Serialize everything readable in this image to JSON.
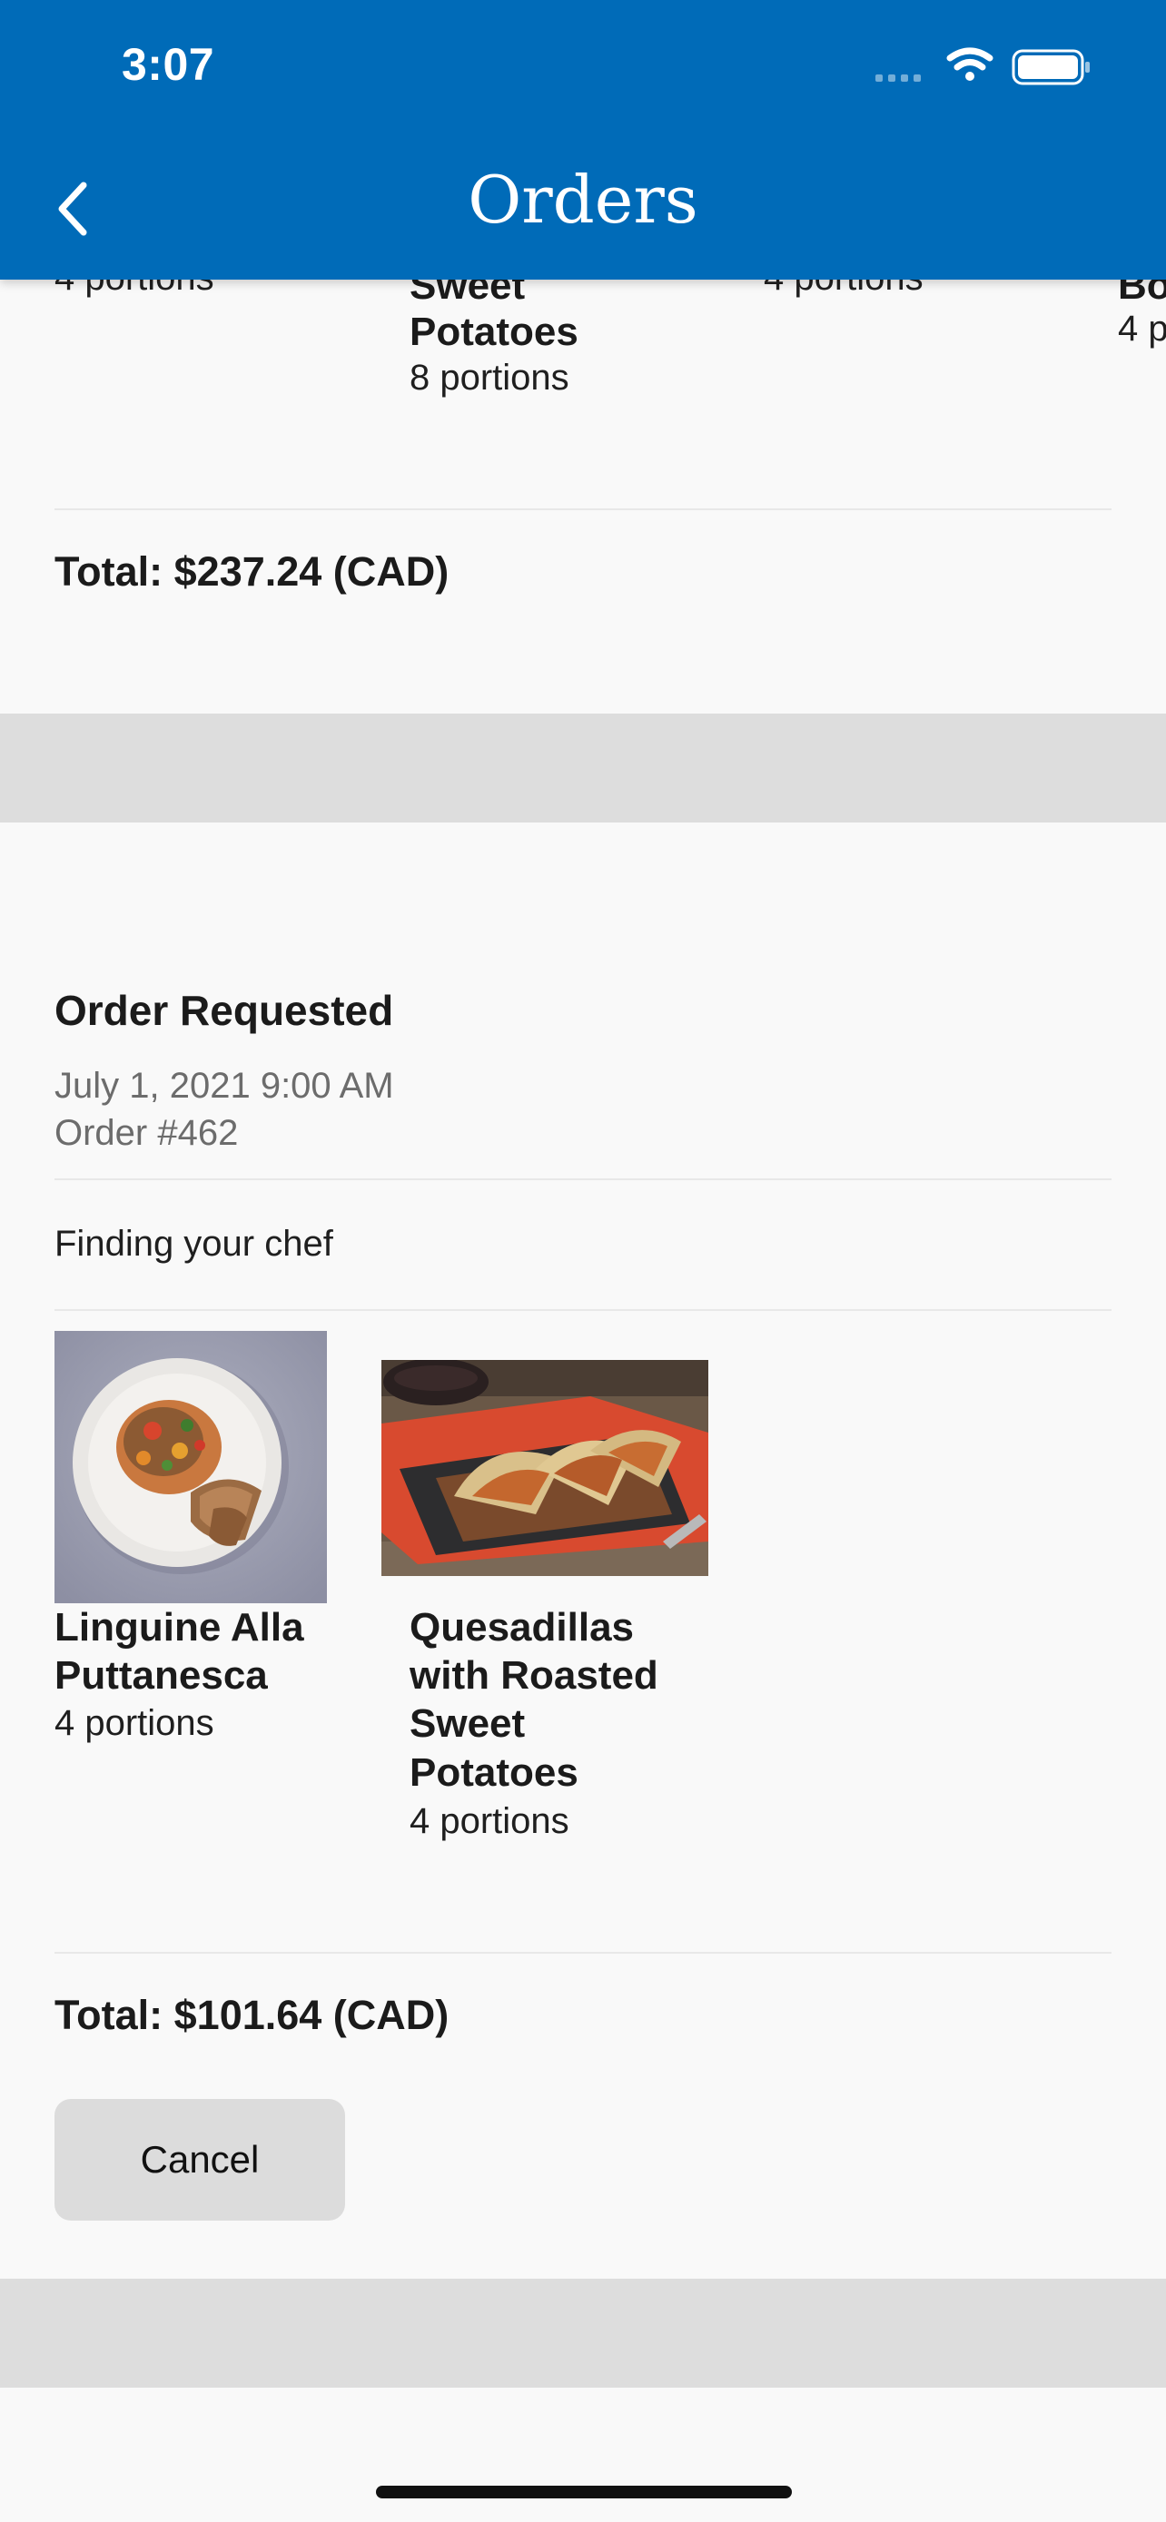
{
  "status_bar": {
    "time": "3:07"
  },
  "header": {
    "title": "Orders"
  },
  "prev_order": {
    "items": [
      {
        "name_tail": "",
        "portions": "4 portions"
      },
      {
        "name_tail_1": "Sweet",
        "name_tail_2": "Potatoes",
        "portions": "8 portions"
      },
      {
        "name_tail": "",
        "portions": "4 portions"
      },
      {
        "name_tail": "Bo",
        "portions": "4 p"
      }
    ],
    "total": "Total: $237.24 (CAD)"
  },
  "order": {
    "status": "Order Requested",
    "date": "July 1, 2021 9:00 AM",
    "number": "Order #462",
    "progress": "Finding your chef",
    "items": [
      {
        "name_line_1": "Linguine Alla",
        "name_line_2": "Puttanesca",
        "portions": "4 portions"
      },
      {
        "name_line_1": "Quesadillas",
        "name_line_2": "with Roasted",
        "name_line_3": "Sweet",
        "name_line_4": "Potatoes",
        "portions": "4 portions"
      }
    ],
    "total": "Total: $101.64 (CAD)",
    "cancel_label": "Cancel"
  },
  "colors": {
    "header_bg": "#006bb8",
    "separator": "#dddddd",
    "button_bg": "#dcdcdc"
  },
  "icons": {
    "back": "chevron-left-icon",
    "signal": "signal-icon",
    "wifi": "wifi-icon",
    "battery": "battery-icon"
  }
}
